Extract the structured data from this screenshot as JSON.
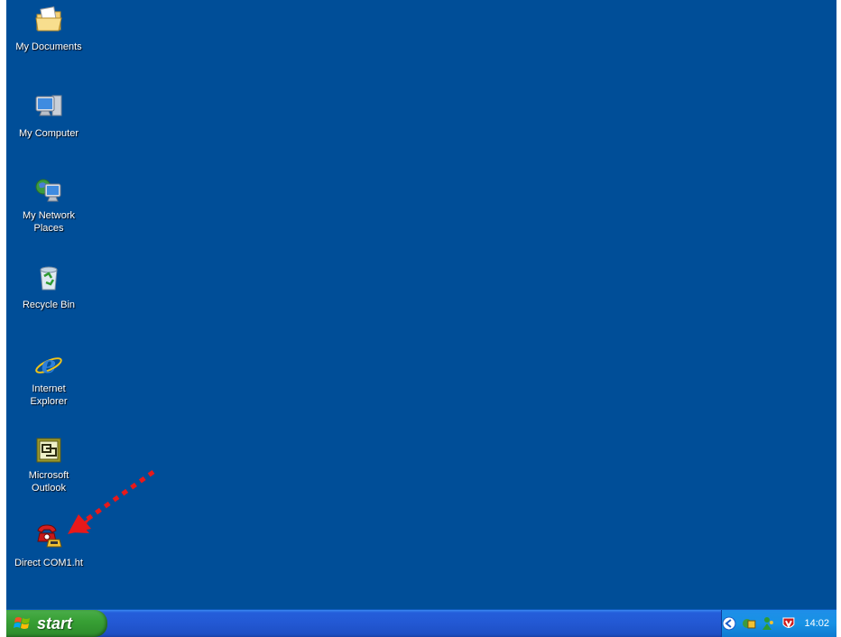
{
  "desktop": {
    "icons": [
      {
        "label": "My Documents"
      },
      {
        "label": "My Computer"
      },
      {
        "label": "My Network Places"
      },
      {
        "label": "Recycle Bin"
      },
      {
        "label": "Internet Explorer"
      },
      {
        "label": "Microsoft Outlook"
      },
      {
        "label": "Direct COM1.ht"
      }
    ]
  },
  "taskbar": {
    "start_label": "start",
    "clock": "14:02"
  },
  "colors": {
    "desktop_bg": "#004e98",
    "taskbar_blue": "#245edb",
    "start_green": "#38a035",
    "annotation_arrow": "#e8191a"
  }
}
